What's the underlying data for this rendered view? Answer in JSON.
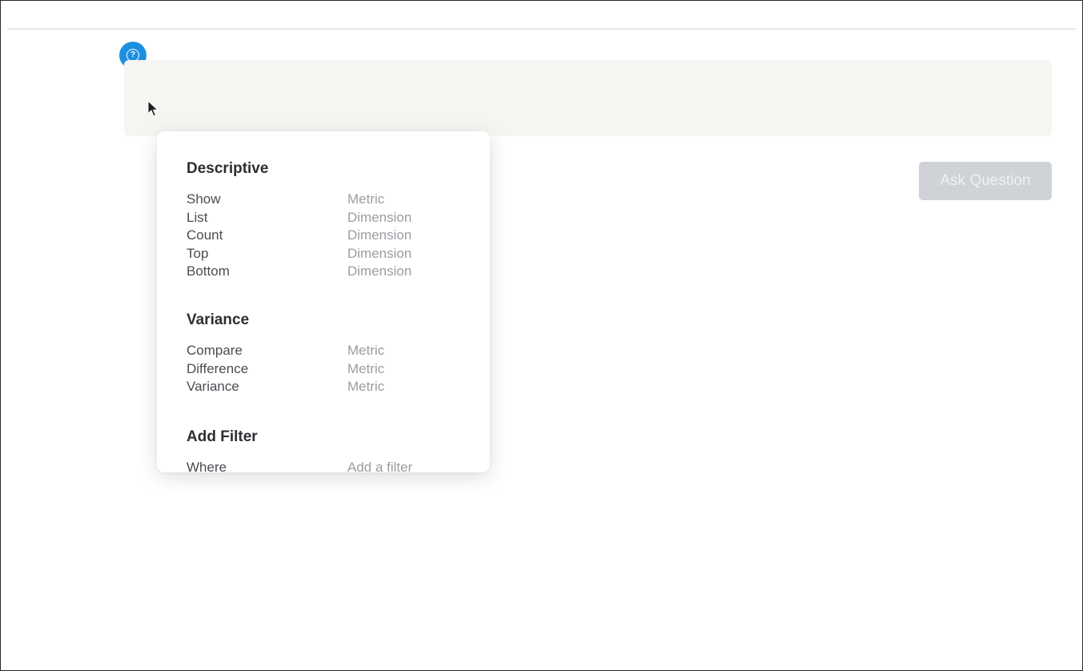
{
  "help": {
    "icon": "question-help-icon",
    "glyph": "?",
    "color": "#1d8fe1"
  },
  "question_input": {
    "value": "",
    "placeholder": ""
  },
  "ask_button": {
    "label": "Ask Question"
  },
  "suggestions": {
    "sections": [
      {
        "title": "Descriptive",
        "rows": [
          {
            "keyword": "Show",
            "kind": "Metric"
          },
          {
            "keyword": "List",
            "kind": "Dimension"
          },
          {
            "keyword": "Count",
            "kind": "Dimension"
          },
          {
            "keyword": "Top",
            "kind": "Dimension"
          },
          {
            "keyword": "Bottom",
            "kind": "Dimension"
          }
        ]
      },
      {
        "title": "Variance",
        "rows": [
          {
            "keyword": "Compare",
            "kind": "Metric"
          },
          {
            "keyword": "Difference",
            "kind": "Metric"
          },
          {
            "keyword": "Variance",
            "kind": "Metric"
          }
        ]
      },
      {
        "title": "Add Filter",
        "rows": [
          {
            "keyword": "Where",
            "kind": "Add a filter"
          }
        ]
      }
    ]
  }
}
